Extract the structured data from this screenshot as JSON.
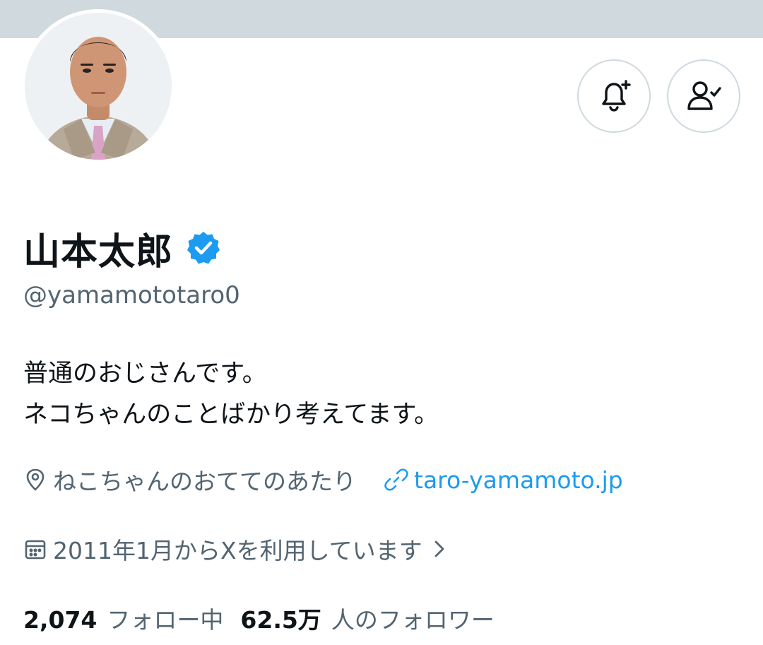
{
  "profile": {
    "display_name": "山本太郎",
    "verified": true,
    "handle": "@yamamototaro0",
    "bio_lines": [
      "普通のおじさんです。",
      "ネコちゃんのことばかり考えてます。"
    ],
    "location": "ねこちゃんのおててのあたり",
    "website": "taro-yamamoto.jp",
    "joined": "2011年1月からXを利用しています"
  },
  "stats": {
    "following_count": "2,074",
    "following_label": "フォロー中",
    "followers_count": "62.5万",
    "followers_label": "人のフォロワー"
  },
  "icons": {
    "notify": "bell-plus-icon",
    "following": "person-check-icon",
    "verified": "verified-badge-icon",
    "location": "location-pin-icon",
    "website": "link-icon",
    "joined": "calendar-icon",
    "chevron": "chevron-right-icon"
  },
  "colors": {
    "banner": "#cfd9de",
    "text_primary": "#0f1419",
    "text_secondary": "#536471",
    "accent": "#1d9bf0",
    "button_border": "#cfd9de"
  }
}
